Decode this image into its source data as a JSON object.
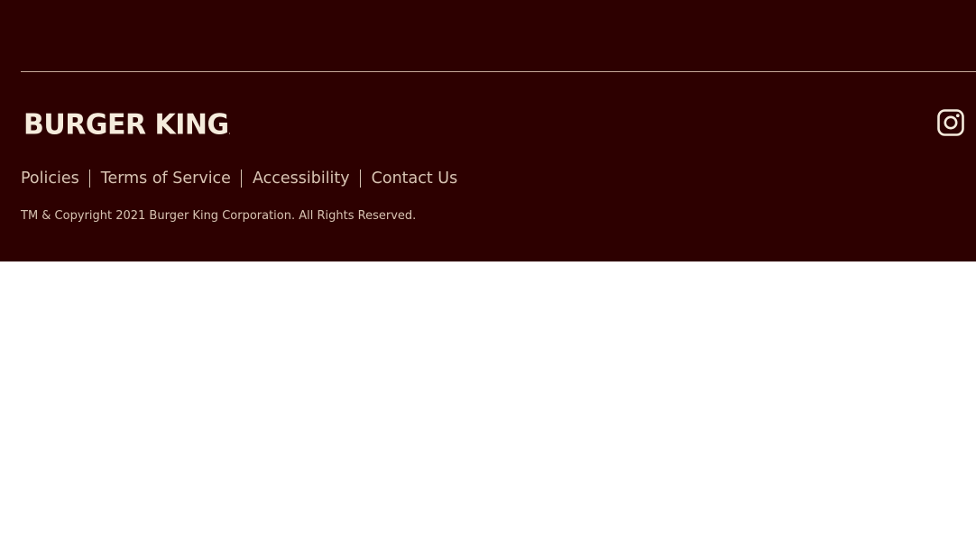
{
  "footer": {
    "brand": "BURGER KING",
    "brand_mark": ".",
    "links": [
      {
        "label": "Policies"
      },
      {
        "label": "Terms of Service"
      },
      {
        "label": "Accessibility"
      },
      {
        "label": "Contact Us"
      }
    ],
    "copyright": "TM & Copyright 2021 Burger King Corporation. All Rights Reserved.",
    "social": [
      {
        "icon": "instagram-icon"
      }
    ]
  },
  "colors": {
    "footer_bg": "#2d0000",
    "text": "#d8c3b2",
    "logo": "#f5ebdc",
    "page_bg": "#ffffff"
  }
}
